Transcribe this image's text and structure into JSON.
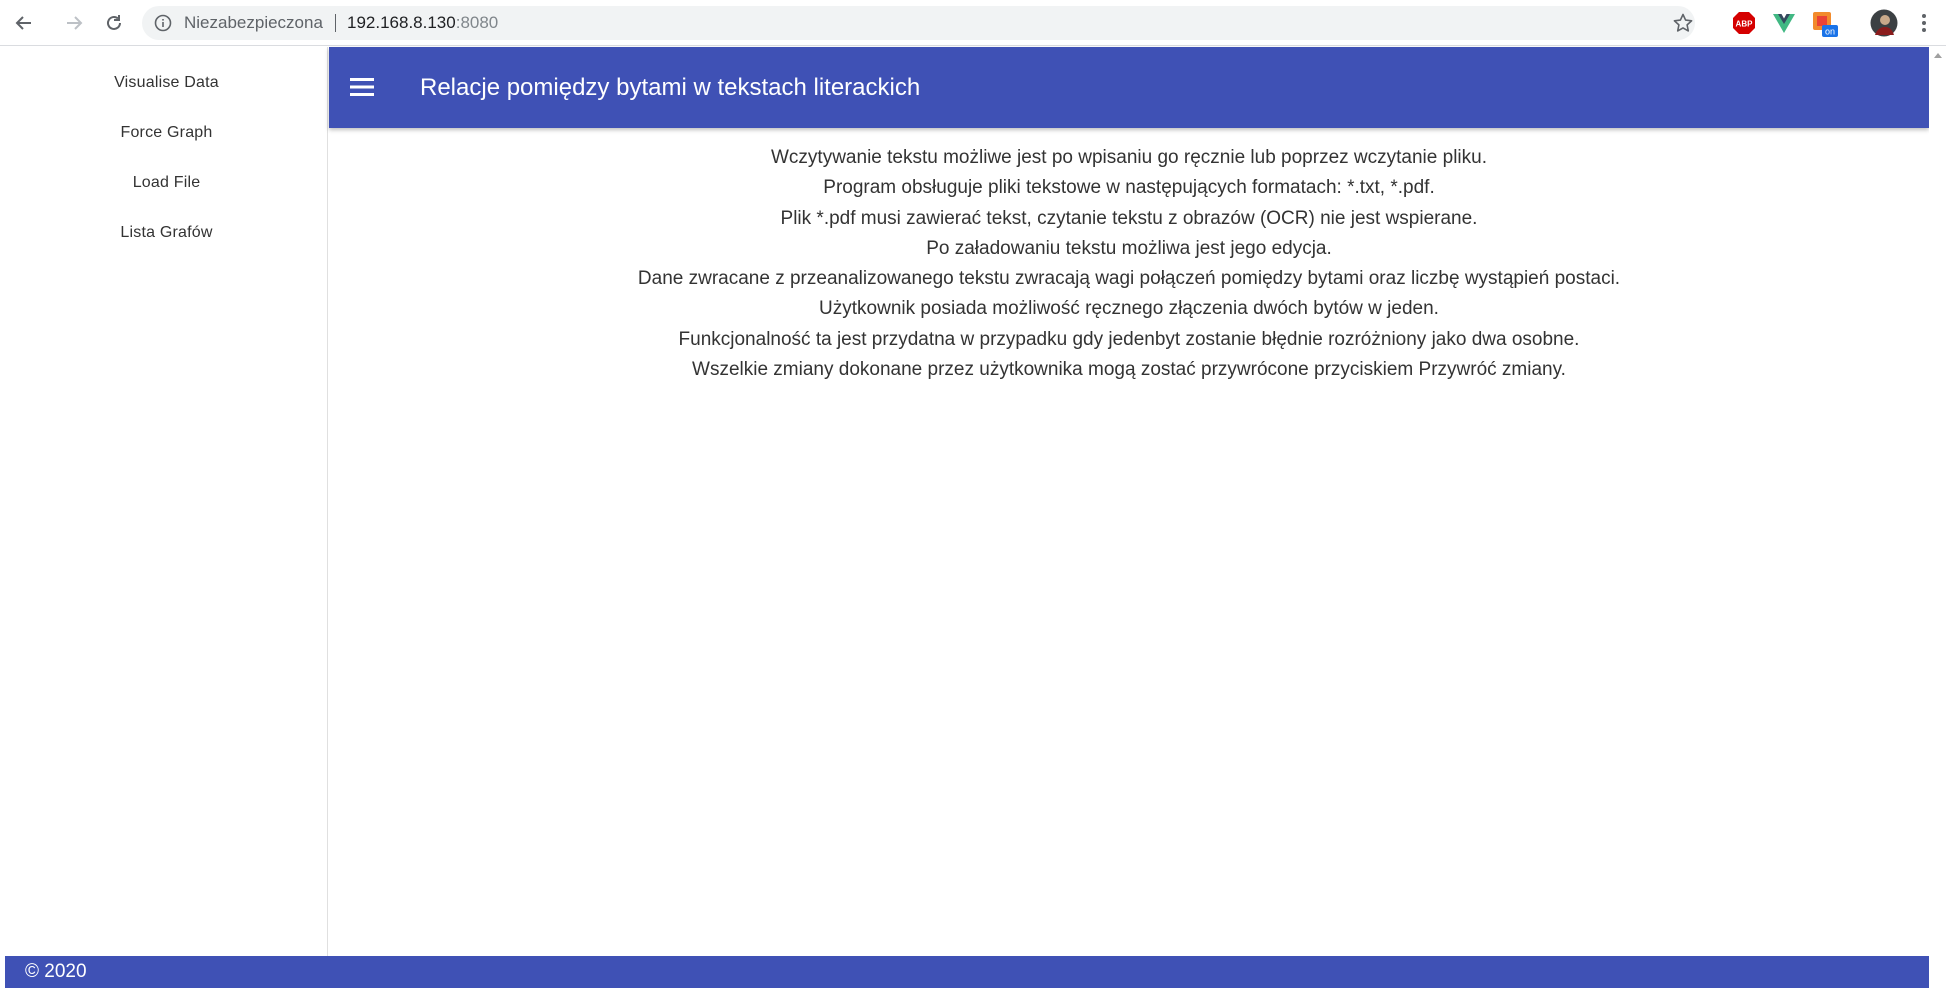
{
  "browser": {
    "security_label": "Niezabezpieczona",
    "url_host": "192.168.8.130",
    "url_port": ":8080",
    "icons": {
      "back": "arrow-back-icon",
      "forward": "arrow-forward-icon",
      "reload": "reload-icon",
      "info": "info-icon",
      "bookmark": "star-icon",
      "adblock": "adblock-icon",
      "vue": "vue-devtools-icon",
      "extension": "extension-on-icon",
      "profile": "avatar",
      "menu": "more-vert-icon"
    },
    "adblock_label": "ABP",
    "extension_badge": "on"
  },
  "sidebar": {
    "items": [
      {
        "label": "Visualise Data"
      },
      {
        "label": "Force Graph"
      },
      {
        "label": "Load File"
      },
      {
        "label": "Lista Grafów"
      }
    ]
  },
  "app_bar": {
    "title": "Relacje pomiędzy bytami w tekstach literackich",
    "menu_icon": "hamburger-menu-icon"
  },
  "content": {
    "lines": [
      "Wczytywanie tekstu możliwe jest po wpisaniu go ręcznie lub poprzez wczytanie pliku.",
      "Program obsługuje pliki tekstowe w następujących formatach: *.txt, *.pdf.",
      "Plik *.pdf musi zawierać tekst, czytanie tekstu z obrazów (OCR) nie jest wspierane.",
      "Po załadowaniu tekstu możliwa jest jego edycja.",
      "Dane zwracane z przeanalizowanego tekstu zwracają wagi połączeń pomiędzy bytami oraz liczbę wystąpień postaci.",
      "Użytkownik posiada możliwość ręcznego złączenia dwóch bytów w jeden.",
      "Funkcjonalność ta jest przydatna w przypadku gdy jedenbyt zostanie błędnie rozróżniony jako dwa osobne.",
      "Wszelkie zmiany dokonane przez użytkownika mogą zostać przywrócone przyciskiem Przywróć zmiany."
    ]
  },
  "footer": {
    "text": "© 2020"
  },
  "colors": {
    "primary": "#3f51b5",
    "text": "#333333",
    "adblock_red": "#d50000",
    "vue_green": "#41b883"
  }
}
